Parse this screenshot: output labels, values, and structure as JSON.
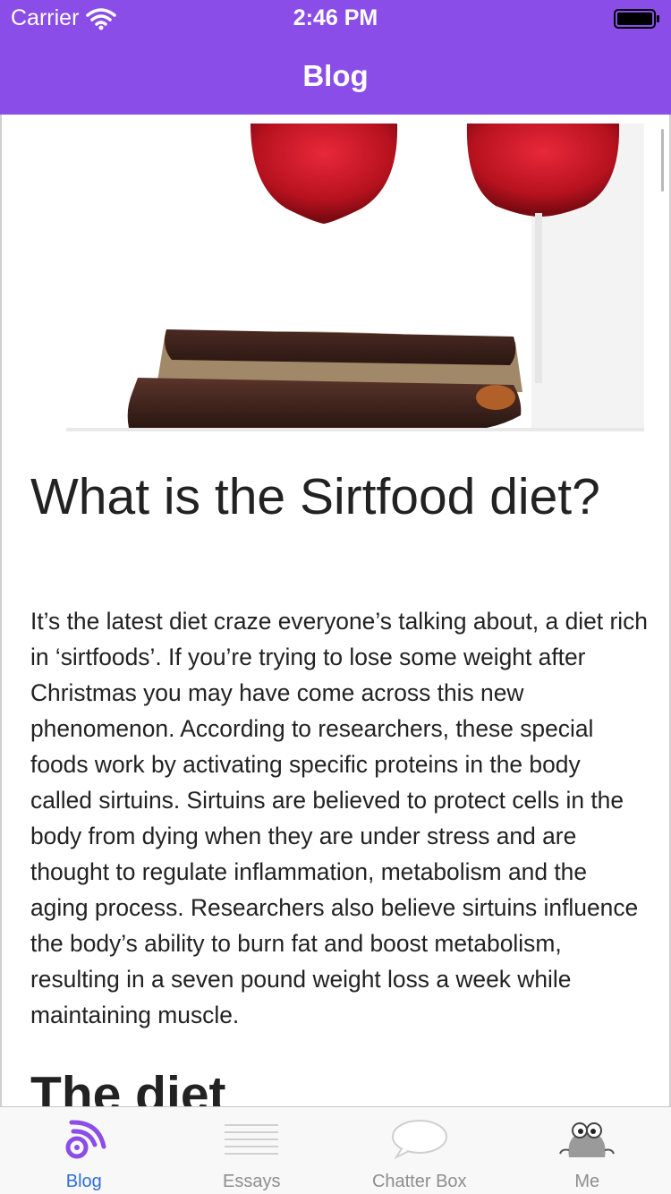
{
  "status_bar": {
    "carrier": "Carrier",
    "time": "2:46 PM"
  },
  "nav": {
    "title": "Blog"
  },
  "article": {
    "title": "What is the Sirtfood diet?",
    "body": "It’s the latest diet craze everyone’s talking about, a diet rich in ‘sirtfoods’.  If you’re trying to lose some weight after Christmas you may have come across this new phenomenon.  According to researchers, these special foods work by activating specific proteins in the body called sirtuins.  Sirtuins are believed to protect cells in the body from dying when they are under stress and are thought to regulate inflammation, metabolism and the aging process.  Researchers also believe sirtuins influence the body’s ability to burn fat and boost metabolism, resulting in a seven pound weight loss a week while maintaining muscle.",
    "next_heading": "The diet"
  },
  "tabs": [
    {
      "label": "Blog",
      "icon": "rss-feed-icon",
      "active": true
    },
    {
      "label": "Essays",
      "icon": "document-lines-icon",
      "active": false
    },
    {
      "label": "Chatter Box",
      "icon": "speech-bubble-icon",
      "active": false
    },
    {
      "label": "Me",
      "icon": "mascot-avatar-icon",
      "active": false
    }
  ],
  "colors": {
    "header": "#8b4de8",
    "active_tab": "#2f6fd6",
    "inactive_tab": "#8e8e8e",
    "text": "#222222"
  }
}
